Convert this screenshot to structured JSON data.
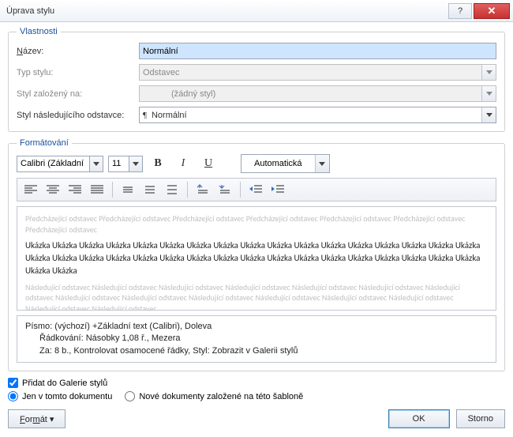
{
  "title": "Úprava stylu",
  "groups": {
    "properties": "Vlastnosti",
    "formatting": "Formátování"
  },
  "labels": {
    "name": "Název:",
    "name_u": "N",
    "type": "Typ stylu:",
    "based": "Styl založený na:",
    "following": "Styl následujícího odstavce:"
  },
  "values": {
    "name": "Normální",
    "type": "Odstavec",
    "based": "(žádný styl)",
    "following": "Normální"
  },
  "format": {
    "font": "Calibri (Základní text)",
    "size": "11",
    "color": "Automatická"
  },
  "preview": {
    "before": "Předcházející odstavec Předcházející odstavec Předcházející odstavec Předcházející odstavec Předcházející odstavec Předcházející odstavec Předcházející odstavec",
    "sample": "Ukázka Ukázka Ukázka Ukázka Ukázka Ukázka Ukázka Ukázka Ukázka Ukázka Ukázka Ukázka Ukázka Ukázka Ukázka Ukázka Ukázka Ukázka Ukázka Ukázka Ukázka Ukázka Ukázka Ukázka Ukázka Ukázka Ukázka Ukázka Ukázka Ukázka Ukázka Ukázka Ukázka Ukázka Ukázka Ukázka",
    "after": "Následující odstavec Následující odstavec Následující odstavec Následující odstavec Následující odstavec Následující odstavec Následující odstavec Následující odstavec Následující odstavec Následující odstavec Následující odstavec Následující odstavec Následující odstavec Následující odstavec Následující odstavec"
  },
  "desc": {
    "line1": "Písmo: (výchozí) +Základní text (Calibri), Doleva",
    "line2": "Řádkování:  Násobky 1,08 ř., Mezera",
    "line3": "Za:  8 b., Kontrolovat osamocené řádky, Styl: Zobrazit v Galerii stylů"
  },
  "options": {
    "add_gallery": "Přidat do Galerie stylů",
    "this_doc": "Jen v tomto dokumentu",
    "new_docs": "Nové dokumenty založené na této šabloně"
  },
  "buttons": {
    "format": "Formát ▾",
    "ok": "OK",
    "cancel": "Storno"
  }
}
